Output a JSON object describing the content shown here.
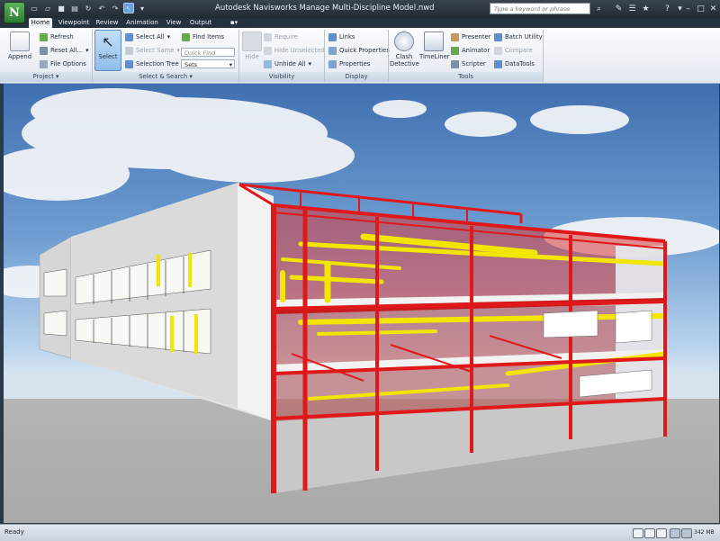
{
  "window": {
    "title": "Autodesk Navisworks Manage     Multi-Discipline Model.nwd",
    "search_placeholder": "Type a keyword or phrase",
    "logo_letter": "N"
  },
  "qat": {
    "icons": [
      "new-file-icon",
      "open-folder-icon",
      "save-icon",
      "print-icon",
      "refresh-icon",
      "undo-icon",
      "redo-icon",
      "select-pointer-icon",
      "dropdown-arrow-icon"
    ]
  },
  "tabs": [
    {
      "label": "Home",
      "active": true
    },
    {
      "label": "Viewpoint"
    },
    {
      "label": "Review"
    },
    {
      "label": "Animation"
    },
    {
      "label": "View"
    },
    {
      "label": "Output"
    }
  ],
  "ribbon": {
    "project": {
      "label": "Project",
      "append": "Append",
      "refresh": "Refresh",
      "reset_all": "Reset All...",
      "file_options": "File Options"
    },
    "select_search": {
      "label": "Select & Search",
      "select": "Select",
      "select_all": "Select All",
      "select_same": "Select Same",
      "selection_tree": "Selection Tree",
      "find_items": "Find Items",
      "quick_find": "Quick Find",
      "sets": "Sets"
    },
    "visibility": {
      "label": "Visibility",
      "hide": "Hide",
      "require": "Require",
      "hide_unselected": "Hide Unselected",
      "unhide_all": "Unhide All"
    },
    "display": {
      "label": "Display",
      "links": "Links",
      "quick_properties": "Quick Properties",
      "properties": "Properties"
    },
    "tools": {
      "label": "Tools",
      "clash_detective": "Clash Detective",
      "timeliner": "TimeLiner",
      "presenter": "Presenter",
      "animator": "Animator",
      "scripter": "Scripter",
      "batch_utility": "Batch Utility",
      "compare": "Compare",
      "datatools": "DataTools"
    }
  },
  "status": {
    "text": "Ready",
    "memory": "342 MB"
  },
  "colors": {
    "steel": "#e0181a",
    "duct": "#f2e600",
    "wall": "#dedede",
    "accent": "#6aa0d8"
  }
}
